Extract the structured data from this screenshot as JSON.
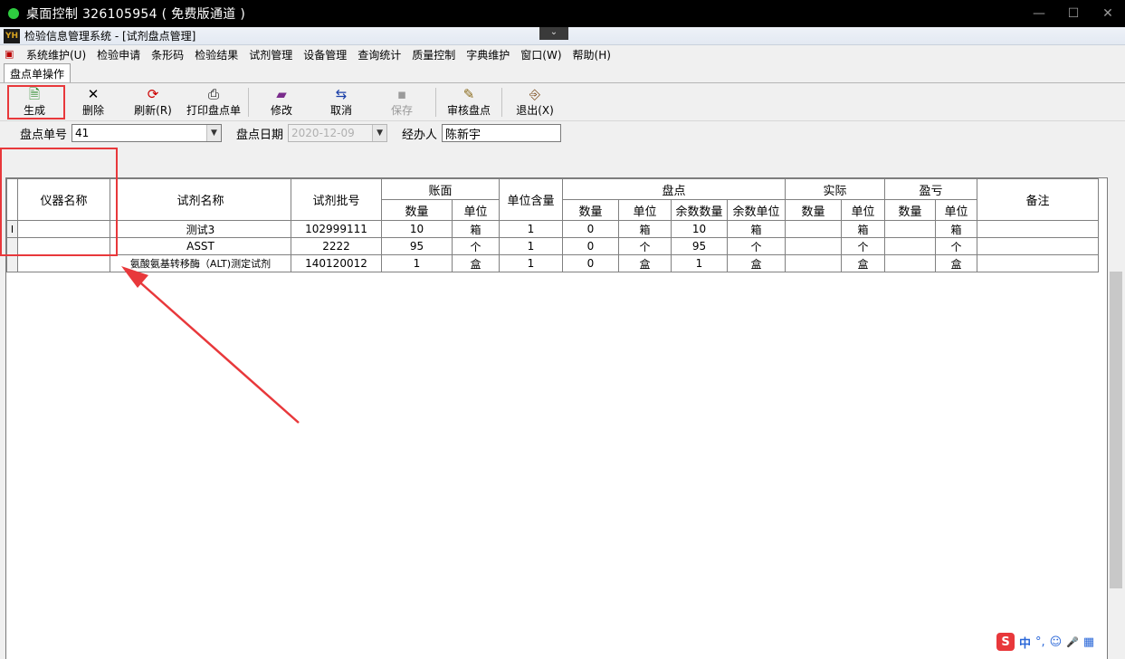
{
  "remote": {
    "title": "桌面控制 326105954 ( 免费版通道 )",
    "minimize": "—",
    "maximize": "☐",
    "close": "✕"
  },
  "app": {
    "title": "检验信息管理系统 - [试剂盘点管理]",
    "logo": "YH",
    "dropdown_tab": "⌄"
  },
  "menu": [
    "系统维护(U)",
    "检验申请",
    "条形码",
    "检验结果",
    "试剂管理",
    "设备管理",
    "查询统计",
    "质量控制",
    "字典维护",
    "窗口(W)",
    "帮助(H)"
  ],
  "tab": "盘点单操作",
  "toolbar": {
    "generate": "生成",
    "delete": "删除",
    "refresh": "刷新(R)",
    "print": "打印盘点单",
    "edit": "修改",
    "cancel": "取消",
    "save": "保存",
    "audit": "审核盘点",
    "exit": "退出(X)"
  },
  "fields": {
    "order_label": "盘点单号",
    "order_value": "41",
    "date_label": "盘点日期",
    "date_value": "2020-12-09",
    "handler_label": "经办人",
    "handler_value": "陈新宇"
  },
  "grid": {
    "headers": {
      "instrument": "仪器名称",
      "reagent": "试剂名称",
      "batch": "试剂批号",
      "book": "账面",
      "unit_content": "单位含量",
      "check": "盘点",
      "actual": "实际",
      "profit_loss": "盈亏",
      "remark": "备注",
      "qty": "数量",
      "unit": "单位",
      "rem_qty": "余数数量",
      "rem_unit": "余数单位"
    },
    "rows": [
      {
        "ind": "I",
        "instrument": "",
        "reagent": "测试3",
        "batch": "102999111",
        "book_qty": "10",
        "book_unit": "箱",
        "unit_content": "1",
        "check_qty": "0",
        "check_unit": "箱",
        "rem_qty": "10",
        "rem_unit": "箱",
        "act_qty": "",
        "act_unit": "箱",
        "pl_qty": "",
        "pl_unit": "箱",
        "remark": ""
      },
      {
        "ind": "",
        "instrument": "",
        "reagent": "ASST",
        "batch": "2222",
        "book_qty": "95",
        "book_unit": "个",
        "unit_content": "1",
        "check_qty": "0",
        "check_unit": "个",
        "rem_qty": "95",
        "rem_unit": "个",
        "act_qty": "",
        "act_unit": "个",
        "pl_qty": "",
        "pl_unit": "个",
        "remark": ""
      },
      {
        "ind": "",
        "instrument": "",
        "reagent": "氨酸氨基转移酶（ALT)测定试剂",
        "batch": "140120012",
        "book_qty": "1",
        "book_unit": "盒",
        "unit_content": "1",
        "check_qty": "0",
        "check_unit": "盒",
        "rem_qty": "1",
        "rem_unit": "盒",
        "act_qty": "",
        "act_unit": "盒",
        "pl_qty": "",
        "pl_unit": "盒",
        "remark": ""
      }
    ]
  },
  "ime": {
    "logo": "S",
    "lang": "中",
    "punct": "°,",
    "emoji": "☺",
    "mic": "🎤",
    "grid": "▦"
  },
  "colors": {
    "annotation": "#e8383b"
  }
}
